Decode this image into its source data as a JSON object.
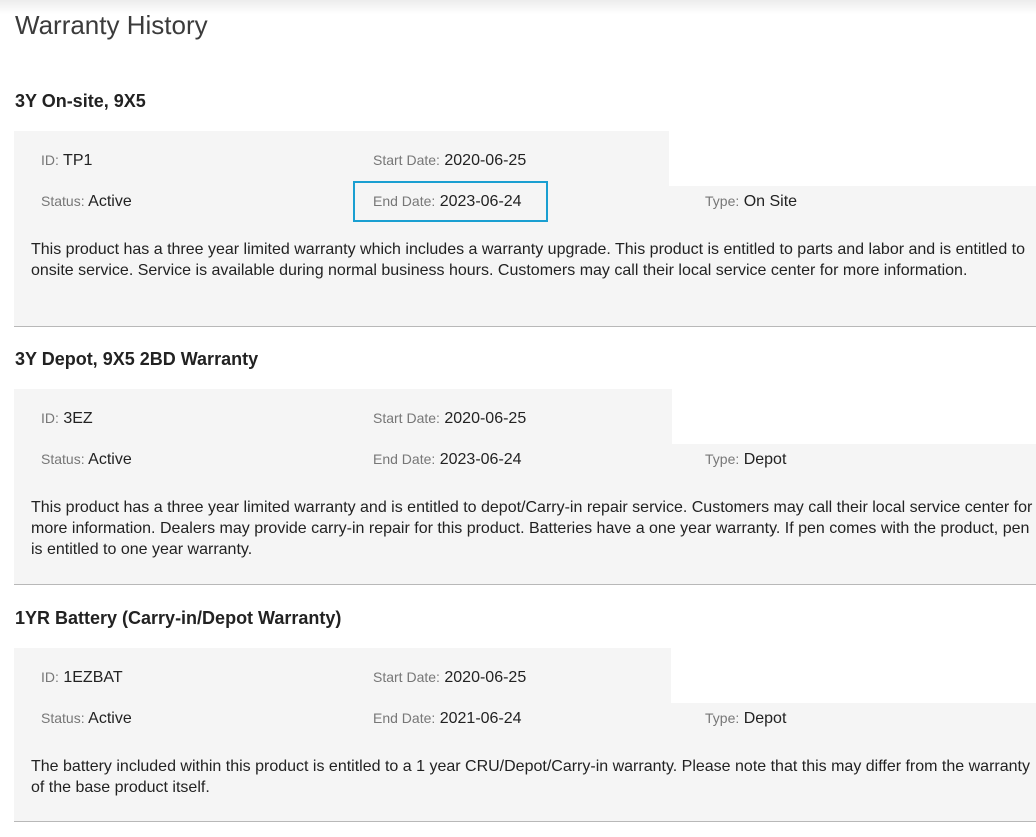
{
  "page": {
    "title": "Warranty History"
  },
  "labels": {
    "id": "ID:",
    "status": "Status:",
    "start_date": "Start Date:",
    "end_date": "End Date:",
    "type": "Type:"
  },
  "warranties": [
    {
      "title": "3Y On-site, 9X5",
      "id": "TP1",
      "status": "Active",
      "start_date": "2020-06-25",
      "end_date": "2023-06-24",
      "type": "On Site",
      "description": "This product has a three year limited warranty which includes a warranty upgrade. This product is entitled to parts and labor and is entitled to onsite service. Service is available during normal business hours. Customers may call their local service center for more information."
    },
    {
      "title": "3Y Depot, 9X5 2BD Warranty",
      "id": "3EZ",
      "status": "Active",
      "start_date": "2020-06-25",
      "end_date": "2023-06-24",
      "type": "Depot",
      "description": "This product has a three year limited warranty and is entitled to depot/Carry-in repair service. Customers may call their local service center for more information. Dealers may provide carry-in repair for this product. Batteries have a one year warranty. If pen comes with the product, pen is entitled to one year warranty."
    },
    {
      "title": "1YR Battery (Carry-in/Depot Warranty)",
      "id": "1EZBAT",
      "status": "Active",
      "start_date": "2020-06-25",
      "end_date": "2021-06-24",
      "type": "Depot",
      "description": "The battery included within this product is entitled to a 1 year CRU/Depot/Carry-in warranty. Please note that this may differ from the warranty of the base product itself."
    }
  ],
  "highlight_color": "#1a9fd1"
}
